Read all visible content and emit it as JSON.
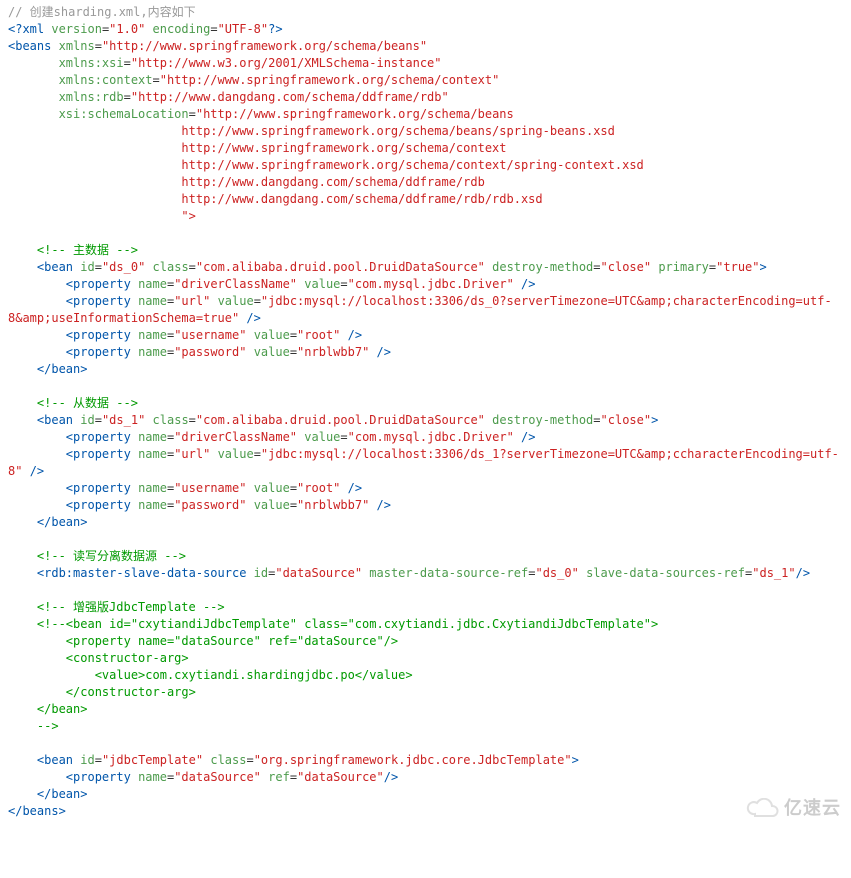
{
  "code": {
    "l1_comment": "// 创建sharding.xml,内容如下",
    "xml_decl": {
      "open": "<?xml",
      "a1n": "version",
      "a1v": "\"1.0\"",
      "a2n": "encoding",
      "a2v": "\"UTF-8\"",
      "close": "?>"
    },
    "beans_open": {
      "tag": "<beans",
      "xmlns_n": "xmlns",
      "xmlns_v": "\"http://www.springframework.org/schema/beans\""
    },
    "xmlns_xsi": {
      "n": "xmlns:xsi",
      "v": "\"http://www.w3.org/2001/XMLSchema-instance\""
    },
    "xmlns_ctx": {
      "n": "xmlns:context",
      "v": "\"http://www.springframework.org/schema/context\""
    },
    "xmlns_rdb": {
      "n": "xmlns:rdb",
      "v": "\"http://www.dangdang.com/schema/ddframe/rdb\""
    },
    "schemaLoc": {
      "n": "xsi:schemaLocation",
      "v_open": "\"http://www.springframework.org/schema/beans"
    },
    "schemaLoc_lines": [
      "http://www.springframework.org/schema/beans/spring-beans.xsd",
      "http://www.springframework.org/schema/context",
      "http://www.springframework.org/schema/context/spring-context.xsd",
      "http://www.dangdang.com/schema/ddframe/rdb",
      "http://www.dangdang.com/schema/ddframe/rdb/rdb.xsd"
    ],
    "schemaLoc_close": "\">",
    "c_master": "<!-- 主数据 -->",
    "bean0": {
      "open": "<bean",
      "id_n": "id",
      "id_v": "\"ds_0\"",
      "class_n": "class",
      "class_v": "\"com.alibaba.druid.pool.DruidDataSource\"",
      "dm_n": "destroy-method",
      "dm_v": "\"close\"",
      "pr_n": "primary",
      "pr_v": "\"true\"",
      "end": ">"
    },
    "prop_tag": "<property",
    "slash_end": "/>",
    "p0_driver": {
      "nn": "name",
      "nv": "\"driverClassName\"",
      "vn": "value",
      "vv": "\"com.mysql.jdbc.Driver\""
    },
    "p0_url": {
      "nn": "name",
      "nv": "\"url\"",
      "vn": "value",
      "vv": "\"jdbc:mysql://localhost:3306/ds_0?serverTimezone=UTC&amp;characterEncoding=utf-8&amp;useInformationSchema=true\""
    },
    "p0_user": {
      "nn": "name",
      "nv": "\"username\"",
      "vn": "value",
      "vv": "\"root\""
    },
    "p0_pass": {
      "nn": "name",
      "nv": "\"password\"",
      "vn": "value",
      "vv": "\"nrblwbb7\""
    },
    "bean_close": "</bean>",
    "c_slave": "<!-- 从数据 -->",
    "bean1": {
      "open": "<bean",
      "id_n": "id",
      "id_v": "\"ds_1\"",
      "class_n": "class",
      "class_v": "\"com.alibaba.druid.pool.DruidDataSource\"",
      "dm_n": "destroy-method",
      "dm_v": "\"close\"",
      "end": ">"
    },
    "p1_driver": {
      "nn": "name",
      "nv": "\"driverClassName\"",
      "vn": "value",
      "vv": "\"com.mysql.jdbc.Driver\""
    },
    "p1_url": {
      "nn": "name",
      "nv": "\"url\"",
      "vn": "value",
      "vv": "\"jdbc:mysql://localhost:3306/ds_1?serverTimezone=UTC&amp;ccharacterEncoding=utf-8\""
    },
    "p1_user": {
      "nn": "name",
      "nv": "\"username\"",
      "vn": "value",
      "vv": "\"root\""
    },
    "p1_pass": {
      "nn": "name",
      "nv": "\"password\"",
      "vn": "value",
      "vv": "\"nrblwbb7\""
    },
    "c_rw": "<!-- 读写分离数据源 -->",
    "rdb": {
      "open": "<rdb:master-slave-data-source",
      "id_n": "id",
      "id_v": "\"dataSource\"",
      "m_n": "master-data-source-ref",
      "m_v": "\"ds_0\"",
      "s_n": "slave-data-sources-ref",
      "s_v": "\"ds_1\"",
      "end": "/>"
    },
    "c_enh": "<!-- 增强版JdbcTemplate -->",
    "cxy_block": "<!--<bean id=\"cxytiandiJdbcTemplate\" class=\"com.cxytiandi.jdbc.CxytiandiJdbcTemplate\">\n        <property name=\"dataSource\" ref=\"dataSource\"/>\n        <constructor-arg>\n            <value>com.cxytiandi.shardingjdbc.po</value>\n        </constructor-arg>\n    </bean>\n    -->",
    "bean_jt": {
      "open": "<bean",
      "id_n": "id",
      "id_v": "\"jdbcTemplate\"",
      "class_n": "class",
      "class_v": "\"org.springframework.jdbc.core.JdbcTemplate\"",
      "end": ">"
    },
    "p_jt": {
      "nn": "name",
      "nv": "\"dataSource\"",
      "rn": "ref",
      "rv": "\"dataSource\""
    },
    "beans_close": "</beans>"
  },
  "watermark": "亿速云"
}
